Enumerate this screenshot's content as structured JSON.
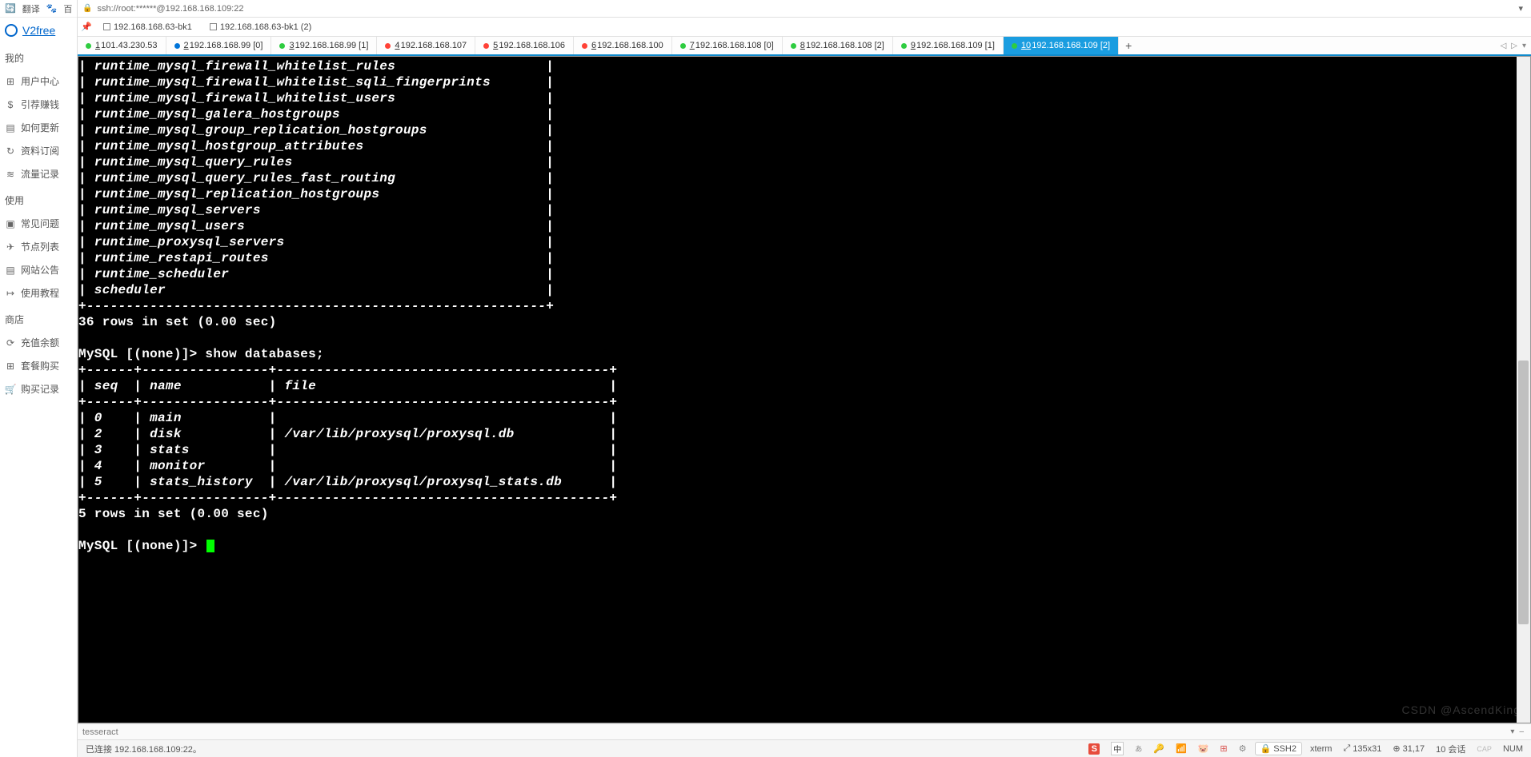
{
  "sidebar": {
    "top_tabs": [
      "翻译",
      "百"
    ],
    "logo_text": "V2free",
    "sections": [
      {
        "title": "我的",
        "items": [
          {
            "icon": "⊞",
            "label": "用户中心",
            "name": "sidebar-item-user-center"
          },
          {
            "icon": "$",
            "label": "引荐赚钱",
            "name": "sidebar-item-referral"
          },
          {
            "icon": "▤",
            "label": "如何更新",
            "name": "sidebar-item-howto-update"
          },
          {
            "icon": "↻",
            "label": "资料订阅",
            "name": "sidebar-item-subscribe"
          },
          {
            "icon": "≋",
            "label": "流量记录",
            "name": "sidebar-item-traffic-log"
          }
        ]
      },
      {
        "title": "使用",
        "items": [
          {
            "icon": "▣",
            "label": "常见问题",
            "name": "sidebar-item-faq"
          },
          {
            "icon": "✈",
            "label": "节点列表",
            "name": "sidebar-item-node-list"
          },
          {
            "icon": "▤",
            "label": "网站公告",
            "name": "sidebar-item-site-notice"
          },
          {
            "icon": "↦",
            "label": "使用教程",
            "name": "sidebar-item-tutorial"
          }
        ]
      },
      {
        "title": "商店",
        "items": [
          {
            "icon": "⟳",
            "label": "充值余额",
            "name": "sidebar-item-recharge"
          },
          {
            "icon": "⊞",
            "label": "套餐购买",
            "name": "sidebar-item-plan-buy"
          },
          {
            "icon": "🛒",
            "label": "购买记录",
            "name": "sidebar-item-purchase-log"
          }
        ]
      }
    ]
  },
  "address_bar": {
    "text": "ssh://root:******@192.168.168.109:22"
  },
  "session_tabs": [
    {
      "label": "192.168.168.63-bk1"
    },
    {
      "label": "192.168.168.63-bk1 (2)"
    }
  ],
  "conn_tabs": [
    {
      "dot": "green",
      "num": "1",
      "label": "101.43.230.53",
      "active": false
    },
    {
      "dot": "blue",
      "num": "2",
      "label": "192.168.168.99 [0]",
      "active": false
    },
    {
      "dot": "green",
      "num": "3",
      "label": "192.168.168.99 [1]",
      "active": false
    },
    {
      "dot": "red",
      "num": "4",
      "label": "192.168.168.107",
      "active": false
    },
    {
      "dot": "red",
      "num": "5",
      "label": "192.168.168.106",
      "active": false
    },
    {
      "dot": "red",
      "num": "6",
      "label": "192.168.168.100",
      "active": false
    },
    {
      "dot": "green",
      "num": "7",
      "label": "192.168.168.108 [0]",
      "active": false
    },
    {
      "dot": "green",
      "num": "8",
      "label": "192.168.168.108 [2]",
      "active": false
    },
    {
      "dot": "green",
      "num": "9",
      "label": "192.168.168.109 [1]",
      "active": false
    },
    {
      "dot": "green",
      "num": "10",
      "label": "192.168.168.109 [2]",
      "active": true
    }
  ],
  "terminal": {
    "row_width": 57,
    "table_rows": [
      "runtime_mysql_firewall_whitelist_rules",
      "runtime_mysql_firewall_whitelist_sqli_fingerprints",
      "runtime_mysql_firewall_whitelist_users",
      "runtime_mysql_galera_hostgroups",
      "runtime_mysql_group_replication_hostgroups",
      "runtime_mysql_hostgroup_attributes",
      "runtime_mysql_query_rules",
      "runtime_mysql_query_rules_fast_routing",
      "runtime_mysql_replication_hostgroups",
      "runtime_mysql_servers",
      "runtime_mysql_users",
      "runtime_proxysql_servers",
      "runtime_restapi_routes",
      "runtime_scheduler",
      "scheduler"
    ],
    "rows_msg": "36 rows in set (0.00 sec)",
    "prompt1": "MySQL [(none)]> show databases;",
    "db_header_seq": "seq",
    "db_header_name": "name",
    "db_header_file": "file",
    "db_rows": [
      {
        "seq": "0",
        "name": "main",
        "file": ""
      },
      {
        "seq": "2",
        "name": "disk",
        "file": "/var/lib/proxysql/proxysql.db"
      },
      {
        "seq": "3",
        "name": "stats",
        "file": ""
      },
      {
        "seq": "4",
        "name": "monitor",
        "file": ""
      },
      {
        "seq": "5",
        "name": "stats_history",
        "file": "/var/lib/proxysql/proxysql_stats.db"
      }
    ],
    "rows_msg2": "5 rows in set (0.00 sec)",
    "prompt2": "MySQL [(none)]> ",
    "watermark": "CSDN @AscendKing"
  },
  "below_term": {
    "label": "tesseract"
  },
  "status_bar": {
    "connected": "已连接 192.168.168.109:22。",
    "ssh": "SSH2",
    "term": "xterm",
    "size": "135x31",
    "pos": "31,17",
    "sessions": "10 会话",
    "caps": "NUM",
    "ime_s": "S",
    "ime_cn": "中",
    "ime_abc": "あ"
  }
}
